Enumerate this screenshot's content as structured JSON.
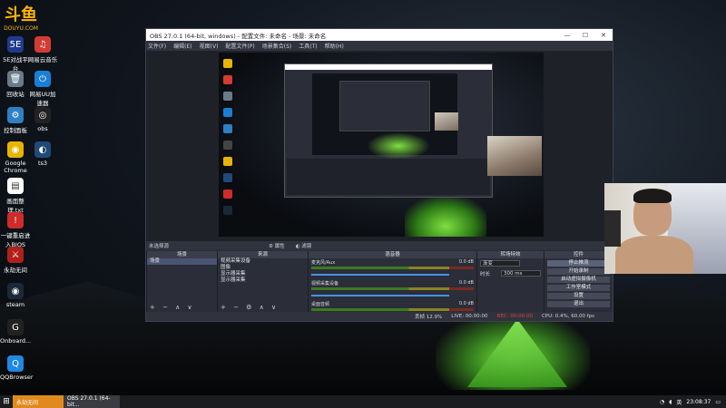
{
  "desktop": {
    "logo": {
      "mark": "斗鱼",
      "url": "DOUYU.COM"
    },
    "icons": [
      {
        "label": "5E对战平台",
        "color": "#1f3b8c",
        "glyph": "5E"
      },
      {
        "label": "网易云音乐",
        "color": "#d43c33",
        "glyph": "♫"
      },
      {
        "label": "回收站",
        "color": "#6a7a8a",
        "glyph": "🗑"
      },
      {
        "label": "网易UU加速器",
        "color": "#1a7fd4",
        "glyph": "⏻"
      },
      {
        "label": "控制面板",
        "color": "#2f7fc4",
        "glyph": "⚙"
      },
      {
        "label": "obs",
        "color": "#222222",
        "glyph": "◎"
      },
      {
        "label": "Google Chrome",
        "color": "#e9b400",
        "glyph": "◉"
      },
      {
        "label": "ts3",
        "color": "#1f4a7a",
        "glyph": "◐"
      },
      {
        "label": "画面整理.txt",
        "color": "#ffffff",
        "glyph": "▤"
      },
      {
        "label": "一键重启进入BIOS",
        "color": "#d02a2a",
        "glyph": "!"
      },
      {
        "label": "永劫无间",
        "color": "#b0201a",
        "glyph": "⚔"
      },
      {
        "label": "steam",
        "color": "#1b2838",
        "glyph": "◉"
      },
      {
        "label": "Onboard...",
        "color": "#222222",
        "glyph": "G"
      },
      {
        "label": "QQBrowser",
        "color": "#1e88e5",
        "glyph": "Q"
      }
    ]
  },
  "obs": {
    "title": "OBS 27.0.1 (64-bit, windows) - 配置文件: 未命名 - 场景: 未命名",
    "window_buttons": [
      "—",
      "☐",
      "✕"
    ],
    "menu": [
      "文件(F)",
      "编辑(E)",
      "视图(V)",
      "配置文件(P)",
      "场景集合(S)",
      "工具(T)",
      "帮助(H)"
    ],
    "scene_status": {
      "none_selected": "未选择源",
      "properties": "⚙ 属性",
      "filters": "◐ 滤镜"
    },
    "docks": {
      "scenes": {
        "title": "场景",
        "items": [
          "场景"
        ],
        "tools": "+ − ∧ ∨"
      },
      "sources": {
        "title": "来源",
        "items": [
          "视频采集设备",
          "图像",
          "显示器采集",
          "显示器采集"
        ],
        "tools": "+ − ⚙ ∧ ∨"
      },
      "mixer": {
        "title": "混音器",
        "channels": [
          {
            "name": "麦克风/Aux",
            "level": "0.0 dB"
          },
          {
            "name": "视频采集设备",
            "level": "0.0 dB"
          },
          {
            "name": "桌面音频",
            "level": "0.0 dB"
          }
        ]
      },
      "transitions": {
        "title": "转场特效",
        "type": "渐变",
        "duration_label": "时长",
        "duration": "300 ms"
      },
      "controls": {
        "title": "控件",
        "buttons": [
          "停止推流",
          "开始录制",
          "启动虚拟摄像机",
          "工作室模式",
          "设置",
          "退出"
        ]
      }
    },
    "status": {
      "live": "LIVE: 00:00:00",
      "rec": "REC: 00:00:00",
      "cpu": "CPU: 0.4%, 60.00 fps",
      "dropped": "丢帧 12.9%"
    }
  },
  "taskbar": {
    "start_icon": "windows-icon",
    "tasks": [
      "永劫无间",
      "OBS 27.0.1 (64-bit..."
    ],
    "tray_text": "英",
    "time": "23:08:37"
  }
}
